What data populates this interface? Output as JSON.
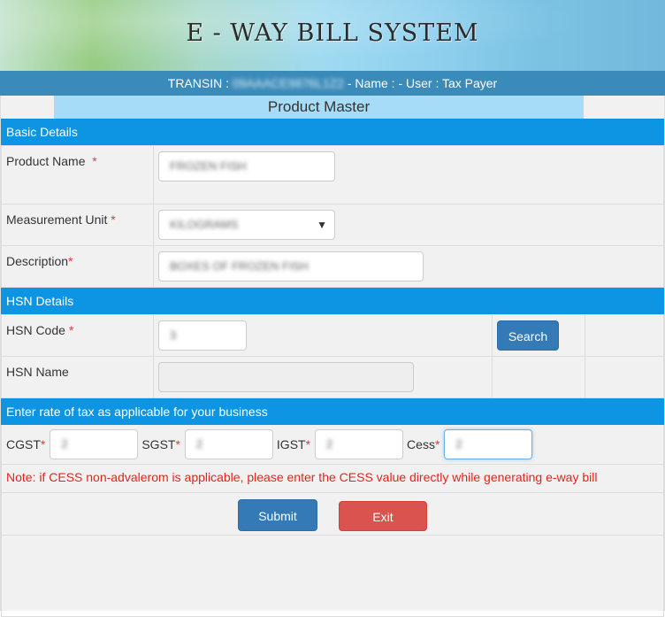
{
  "header": {
    "title": "E - WAY BILL SYSTEM",
    "userbar": {
      "transin_label": "TRANSIN :",
      "transin_value": "09AAACE9876L1Z2",
      "rest": "- Name : - User : Tax Payer"
    }
  },
  "page_title": "Product Master",
  "basic_details": {
    "heading": "Basic Details",
    "product_name": {
      "label": "Product Name",
      "required": "*",
      "value": "FROZEN FISH"
    },
    "measurement_unit": {
      "label": "Measurement Unit",
      "required": "*",
      "value": "KILOGRAMS",
      "caret": "▼"
    },
    "description": {
      "label": "Description",
      "required": "*",
      "value": "BOXES OF FROZEN FISH"
    }
  },
  "hsn_details": {
    "heading": "HSN Details",
    "hsn_code": {
      "label": "HSN Code",
      "required": "*",
      "value": "3"
    },
    "search_label": "Search",
    "hsn_name": {
      "label": "HSN Name",
      "value": ""
    }
  },
  "tax": {
    "heading": "Enter rate of tax as applicable for your business",
    "fields": [
      {
        "label": "CGST",
        "required": "*",
        "value": "2"
      },
      {
        "label": "SGST",
        "required": "*",
        "value": "2"
      },
      {
        "label": "IGST",
        "required": "*",
        "value": "2"
      },
      {
        "label": "Cess",
        "required": "*",
        "value": "2"
      }
    ],
    "note": "Note: if CESS non-advalerom is applicable, please enter the CESS value directly while generating e-way bill"
  },
  "actions": {
    "submit_label": "Submit",
    "exit_label": "Exit"
  }
}
